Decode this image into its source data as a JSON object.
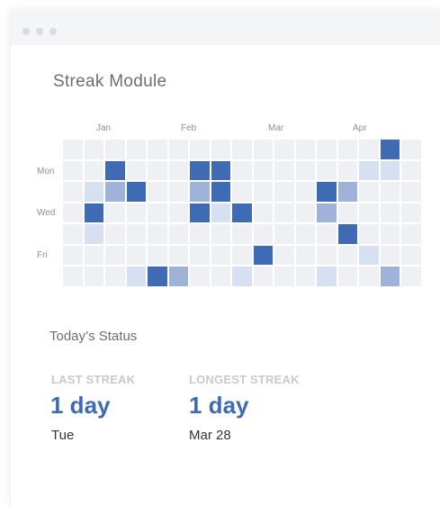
{
  "window": {
    "controls": [
      "dot",
      "dot",
      "dot"
    ]
  },
  "module": {
    "title": "Streak Module",
    "months": [
      "Jan",
      "Feb",
      "Mar",
      "Apr"
    ],
    "days": [
      "Mon",
      "Wed",
      "Fri"
    ],
    "heatmap": {
      "levels": [
        "#eef0f3",
        "#d6e0f1",
        "#9fb3d9",
        "#3f6ab4"
      ],
      "rows": [
        [
          0,
          0,
          0,
          0,
          0,
          0,
          0,
          0,
          0,
          0,
          0,
          0,
          0,
          0,
          0,
          3,
          0
        ],
        [
          0,
          0,
          3,
          0,
          0,
          0,
          3,
          3,
          0,
          0,
          0,
          0,
          0,
          0,
          1,
          1,
          0
        ],
        [
          0,
          1,
          2,
          3,
          0,
          0,
          2,
          3,
          0,
          0,
          0,
          0,
          3,
          2,
          0,
          0,
          0
        ],
        [
          0,
          3,
          0,
          0,
          0,
          0,
          3,
          1,
          3,
          0,
          0,
          0,
          2,
          0,
          0,
          0,
          0
        ],
        [
          0,
          1,
          0,
          0,
          0,
          0,
          0,
          0,
          0,
          0,
          0,
          0,
          0,
          3,
          0,
          0,
          0
        ],
        [
          0,
          0,
          0,
          0,
          0,
          0,
          0,
          0,
          0,
          3,
          0,
          0,
          0,
          0,
          1,
          0,
          0
        ],
        [
          0,
          0,
          0,
          1,
          3,
          2,
          0,
          0,
          1,
          0,
          0,
          0,
          1,
          0,
          0,
          2,
          0
        ]
      ]
    }
  },
  "status": {
    "title": "Today’s Status",
    "last_streak": {
      "label": "LAST STREAK",
      "value": "1 day",
      "sub": "Tue"
    },
    "longest_streak": {
      "label": "LONGEST STREAK",
      "value": "1 day",
      "sub": "Mar 28"
    }
  }
}
